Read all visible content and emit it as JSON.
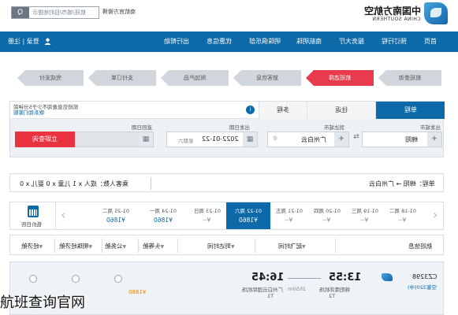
{
  "header": {
    "search_button": "Q",
    "search_placeholder": "航班/城市/目的地提示",
    "weibo_text": "南航官方微博",
    "logo_cn": "中国南方航空",
    "logo_en": "CHINA SOUTHERN"
  },
  "nav": {
    "login": "登录 | 注册",
    "items": [
      "首页",
      "预订行程",
      "服务大厅",
      "南航明珠",
      "明珠俱乐部",
      "优惠信息",
      "出行帮助"
    ]
  },
  "steps": [
    "航班查询",
    "航班选择",
    "旅客信息",
    "附加产品",
    "支付订单",
    "完成支付"
  ],
  "search_panel": {
    "tab_oneway": "单程",
    "tab_round": "往返",
    "tab_multi": "多程",
    "notice_line1": "航班信息查询不少于5分钟前",
    "notice_line2": "联系我们客服",
    "from_label": "出发城市",
    "from_value": "绵阳",
    "to_label": "到达城市",
    "to_value": "广州白云",
    "depart_label": "出发日期",
    "depart_value": "2022-01-22",
    "depart_hint": "星期六",
    "return_label": "返回日期",
    "search_button": "立即查询"
  },
  "route_bar": {
    "route": "单程：绵阳 → 广州白云",
    "pax": "乘客人数：成人 x 1 儿童 x 0 婴儿 x 0"
  },
  "date_strip": {
    "calendar_label": "低价日历",
    "cells": [
      {
        "date": "01-18",
        "weekday": "周二",
        "price": "¥--"
      },
      {
        "date": "01-19",
        "weekday": "周三",
        "price": "¥--"
      },
      {
        "date": "01-20",
        "weekday": "周四",
        "price": "¥--"
      },
      {
        "date": "01-21",
        "weekday": "周五",
        "price": "¥--"
      },
      {
        "date": "01-22",
        "weekday": "周六",
        "price": "¥1860"
      },
      {
        "date": "01-23",
        "weekday": "周日",
        "price": "¥--"
      },
      {
        "date": "01-24",
        "weekday": "周一",
        "price": "¥1860"
      },
      {
        "date": "01-25",
        "weekday": "周二",
        "price": "¥1860"
      }
    ]
  },
  "sort_row": {
    "flight_info": "航班信息",
    "depart_time": "起飞时间",
    "arrive_time": "到达时间",
    "first": "头等舱",
    "business": "公务舱",
    "premium": "明珠经济舱",
    "economy": "经济舱"
  },
  "result": {
    "flight_no": "CZ3298",
    "model": "空客320(中)",
    "dep_time": "13:55",
    "dep_airport": "绵阳南郊机场",
    "dep_term": "T2",
    "arr_time": "16:45",
    "arr_airport": "广州白云国际机场",
    "arr_term": "T1",
    "duration": "2h50m",
    "price_eco": "¥1860"
  },
  "watermark": "航班查询官网"
}
